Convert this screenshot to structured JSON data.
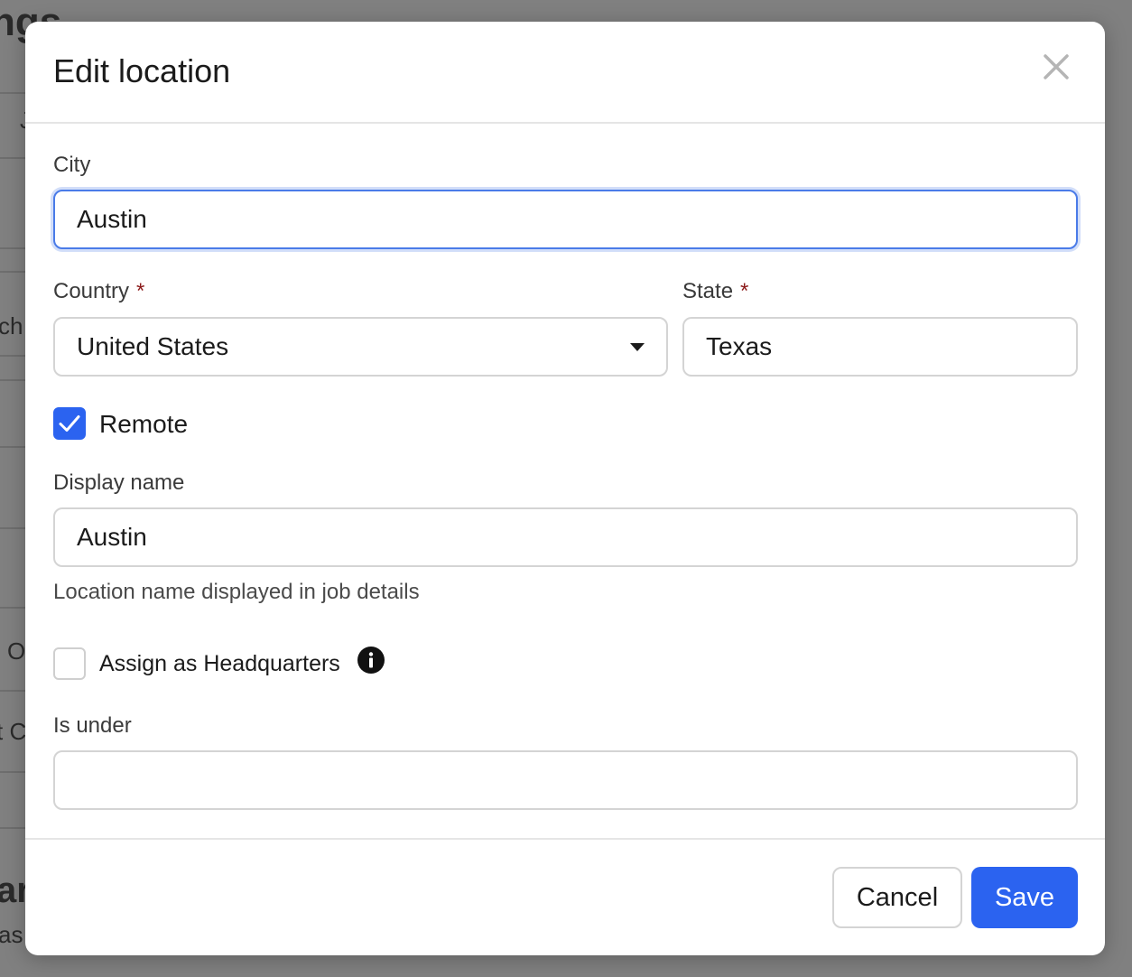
{
  "background": {
    "heading_fragment": "ngs",
    "text_fragments": [
      "J",
      "ch",
      "O",
      "t C",
      "ar",
      "as"
    ]
  },
  "modal": {
    "title": "Edit location",
    "close_icon": "close-icon",
    "city": {
      "label": "City",
      "value": "Austin"
    },
    "country": {
      "label": "Country",
      "required_mark": "*",
      "value": "United States"
    },
    "state": {
      "label": "State",
      "required_mark": "*",
      "value": "Texas"
    },
    "remote": {
      "label": "Remote",
      "checked": true
    },
    "display_name": {
      "label": "Display name",
      "value": "Austin",
      "help": "Location name displayed in job details"
    },
    "headquarters": {
      "label": "Assign as Headquarters",
      "checked": false,
      "icon": "info-icon"
    },
    "is_under": {
      "label": "Is under",
      "value": ""
    },
    "buttons": {
      "cancel": "Cancel",
      "save": "Save"
    }
  },
  "colors": {
    "accent": "#2b63f0",
    "required": "#8b1a1a",
    "focus_ring": "#4a7be8"
  }
}
